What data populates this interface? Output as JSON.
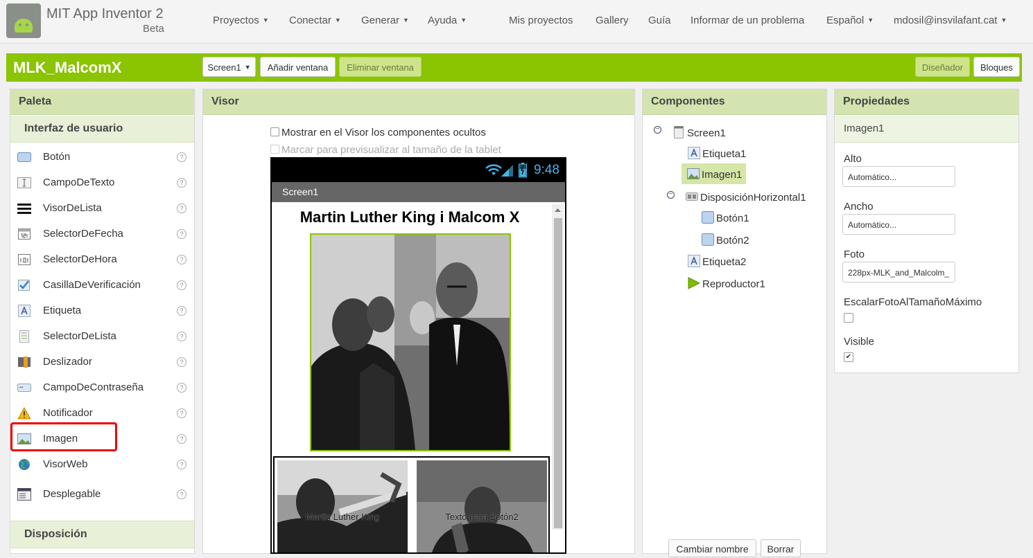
{
  "app": {
    "title": "MIT App Inventor 2",
    "beta": "Beta"
  },
  "nav": {
    "proyectos": "Proyectos",
    "conectar": "Conectar",
    "generar": "Generar",
    "ayuda": "Ayuda",
    "mis_proyectos": "Mis proyectos",
    "gallery": "Gallery",
    "guia": "Guía",
    "informar": "Informar de un problema",
    "idioma": "Español",
    "usuario": "mdosil@insvilafant.cat"
  },
  "project": {
    "name": "MLK_MalcomX",
    "screen_select": "Screen1",
    "add_screen": "Añadir ventana",
    "remove_screen": "Eliminar ventana",
    "designer": "Diseñador",
    "blocks": "Bloques"
  },
  "palette": {
    "title": "Paleta",
    "section": "Interfaz de usuario",
    "items": [
      "Botón",
      "CampoDeTexto",
      "VisorDeLista",
      "SelectorDeFecha",
      "SelectorDeHora",
      "CasillaDeVerificación",
      "Etiqueta",
      "SelectorDeLista",
      "Deslizador",
      "CampoDeContraseña",
      "Notificador",
      "Imagen",
      "VisorWeb",
      "Desplegable"
    ],
    "section2": "Disposición",
    "help": "?"
  },
  "viewer": {
    "title": "Visor",
    "show_hidden": "Mostrar en el Visor los componentes ocultos",
    "tablet_preview": "Marcar para previsualizar al tamaño de la tablet",
    "clock": "9:48",
    "screen_name": "Screen1",
    "screen_title": "Martin Luther King i Malcom X",
    "button1_text": "Martin Luther King",
    "button2_text": "Texto para Botón2"
  },
  "components": {
    "title": "Componentes",
    "tree": [
      "Screen1",
      "Etiqueta1",
      "Imagen1",
      "DisposiciónHorizontal1",
      "Botón1",
      "Botón2",
      "Etiqueta2",
      "Reproductor1"
    ],
    "rename": "Cambiar nombre",
    "delete": "Borrar"
  },
  "properties": {
    "title": "Propiedades",
    "component": "Imagen1",
    "alto_label": "Alto",
    "alto_value": "Automático...",
    "ancho_label": "Ancho",
    "ancho_value": "Automático...",
    "foto_label": "Foto",
    "foto_value": "228px-MLK_and_Malcolm_",
    "escalar_label": "EscalarFotoAlTamañoMáximo",
    "visible_label": "Visible",
    "visible_check": "✔"
  },
  "colors": {
    "accent": "#8bc400",
    "panel_header": "#d3e4b0",
    "highlight": "#e00000"
  }
}
